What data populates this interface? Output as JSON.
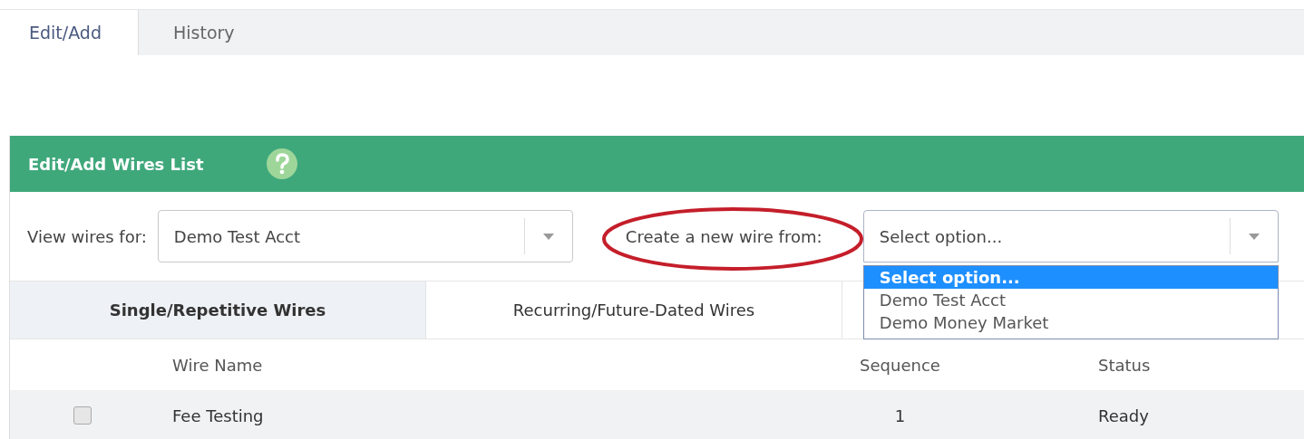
{
  "page_tabs": [
    {
      "label": "Edit/Add",
      "selected": true
    },
    {
      "label": "History",
      "selected": false
    }
  ],
  "panel": {
    "title": "Edit/Add Wires List"
  },
  "filters": {
    "view_label": "View wires for:",
    "view_value": "Demo Test Acct",
    "create_label": "Create a new wire from:",
    "create_value": "Select option...",
    "create_expanded": true,
    "create_options": [
      {
        "label": "Select option...",
        "selected": true
      },
      {
        "label": "Demo Test Acct",
        "selected": false
      },
      {
        "label": "Demo Money Market",
        "selected": false
      }
    ]
  },
  "wire_tabs": [
    {
      "label": "Single/Repetitive Wires",
      "selected": true
    },
    {
      "label": "Recurring/Future-Dated Wires",
      "selected": false
    }
  ],
  "table": {
    "columns": [
      "Wire Name",
      "Sequence",
      "Status"
    ],
    "rows": [
      {
        "checked": false,
        "cells": [
          "Fee Testing",
          "1",
          "Ready"
        ]
      }
    ]
  }
}
